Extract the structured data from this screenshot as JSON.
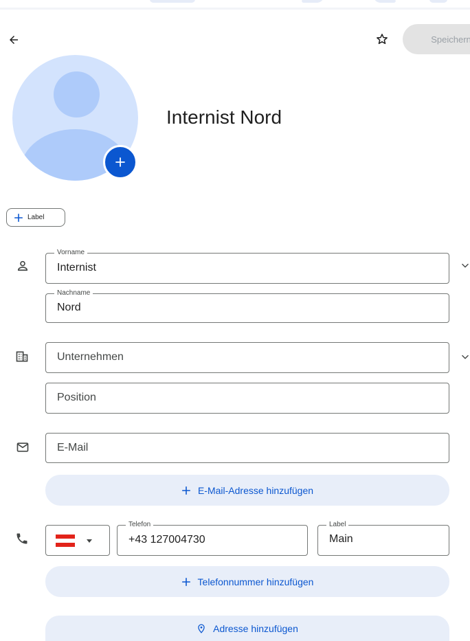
{
  "header": {
    "save_label": "Speichern"
  },
  "contact": {
    "display_name": "Internist Nord"
  },
  "label_chip": {
    "text": "Label"
  },
  "fields": {
    "first_name": {
      "label": "Vorname",
      "value": "Internist"
    },
    "last_name": {
      "label": "Nachname",
      "value": "Nord"
    },
    "company": {
      "placeholder": "Unternehmen"
    },
    "position": {
      "placeholder": "Position"
    },
    "email": {
      "placeholder": "E-Mail"
    },
    "phone": {
      "label": "Telefon",
      "value": "+43 127004730"
    },
    "phone_label": {
      "label": "Label",
      "value": "Main"
    }
  },
  "actions": {
    "add_email": "E-Mail-Adresse hinzufügen",
    "add_phone": "Telefonnummer hinzufügen",
    "add_address": "Adresse hinzufügen"
  },
  "country": {
    "selected": "Austria",
    "flag_colors": [
      "#e2231a",
      "#ffffff",
      "#e2231a"
    ]
  },
  "colors": {
    "accent": "#0b57d0",
    "avatar_bg": "#d3e3fd",
    "avatar_fg": "#aecbfa",
    "pill_bg": "#e8eef9",
    "border": "#747775"
  },
  "icons": [
    "arrow-back-icon",
    "star-icon",
    "plus-icon",
    "person-icon",
    "building-icon",
    "mail-icon",
    "phone-icon",
    "location-pin-icon",
    "chevron-down-icon",
    "dropdown-caret-icon"
  ]
}
